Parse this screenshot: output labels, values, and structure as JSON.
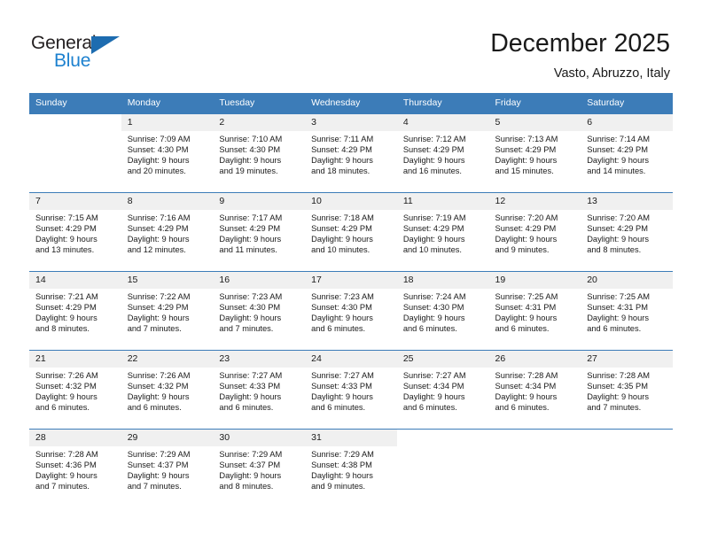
{
  "brand": {
    "name_part1": "General",
    "name_part2": "Blue",
    "triangle_color": "#1d6cb0",
    "blue_color": "#1d81cf"
  },
  "header": {
    "title": "December 2025",
    "subtitle": "Vasto, Abruzzo, Italy"
  },
  "theme": {
    "header_row_bg": "#3c7cb8",
    "daynum_bg": "#f0f0f0",
    "row_border": "#3c7cb8"
  },
  "weekdays": [
    "Sunday",
    "Monday",
    "Tuesday",
    "Wednesday",
    "Thursday",
    "Friday",
    "Saturday"
  ],
  "weeks": [
    [
      {
        "day": "",
        "sunrise": "",
        "sunset": "",
        "daylight1": "",
        "daylight2": ""
      },
      {
        "day": "1",
        "sunrise": "Sunrise: 7:09 AM",
        "sunset": "Sunset: 4:30 PM",
        "daylight1": "Daylight: 9 hours",
        "daylight2": "and 20 minutes."
      },
      {
        "day": "2",
        "sunrise": "Sunrise: 7:10 AM",
        "sunset": "Sunset: 4:30 PM",
        "daylight1": "Daylight: 9 hours",
        "daylight2": "and 19 minutes."
      },
      {
        "day": "3",
        "sunrise": "Sunrise: 7:11 AM",
        "sunset": "Sunset: 4:29 PM",
        "daylight1": "Daylight: 9 hours",
        "daylight2": "and 18 minutes."
      },
      {
        "day": "4",
        "sunrise": "Sunrise: 7:12 AM",
        "sunset": "Sunset: 4:29 PM",
        "daylight1": "Daylight: 9 hours",
        "daylight2": "and 16 minutes."
      },
      {
        "day": "5",
        "sunrise": "Sunrise: 7:13 AM",
        "sunset": "Sunset: 4:29 PM",
        "daylight1": "Daylight: 9 hours",
        "daylight2": "and 15 minutes."
      },
      {
        "day": "6",
        "sunrise": "Sunrise: 7:14 AM",
        "sunset": "Sunset: 4:29 PM",
        "daylight1": "Daylight: 9 hours",
        "daylight2": "and 14 minutes."
      }
    ],
    [
      {
        "day": "7",
        "sunrise": "Sunrise: 7:15 AM",
        "sunset": "Sunset: 4:29 PM",
        "daylight1": "Daylight: 9 hours",
        "daylight2": "and 13 minutes."
      },
      {
        "day": "8",
        "sunrise": "Sunrise: 7:16 AM",
        "sunset": "Sunset: 4:29 PM",
        "daylight1": "Daylight: 9 hours",
        "daylight2": "and 12 minutes."
      },
      {
        "day": "9",
        "sunrise": "Sunrise: 7:17 AM",
        "sunset": "Sunset: 4:29 PM",
        "daylight1": "Daylight: 9 hours",
        "daylight2": "and 11 minutes."
      },
      {
        "day": "10",
        "sunrise": "Sunrise: 7:18 AM",
        "sunset": "Sunset: 4:29 PM",
        "daylight1": "Daylight: 9 hours",
        "daylight2": "and 10 minutes."
      },
      {
        "day": "11",
        "sunrise": "Sunrise: 7:19 AM",
        "sunset": "Sunset: 4:29 PM",
        "daylight1": "Daylight: 9 hours",
        "daylight2": "and 10 minutes."
      },
      {
        "day": "12",
        "sunrise": "Sunrise: 7:20 AM",
        "sunset": "Sunset: 4:29 PM",
        "daylight1": "Daylight: 9 hours",
        "daylight2": "and 9 minutes."
      },
      {
        "day": "13",
        "sunrise": "Sunrise: 7:20 AM",
        "sunset": "Sunset: 4:29 PM",
        "daylight1": "Daylight: 9 hours",
        "daylight2": "and 8 minutes."
      }
    ],
    [
      {
        "day": "14",
        "sunrise": "Sunrise: 7:21 AM",
        "sunset": "Sunset: 4:29 PM",
        "daylight1": "Daylight: 9 hours",
        "daylight2": "and 8 minutes."
      },
      {
        "day": "15",
        "sunrise": "Sunrise: 7:22 AM",
        "sunset": "Sunset: 4:29 PM",
        "daylight1": "Daylight: 9 hours",
        "daylight2": "and 7 minutes."
      },
      {
        "day": "16",
        "sunrise": "Sunrise: 7:23 AM",
        "sunset": "Sunset: 4:30 PM",
        "daylight1": "Daylight: 9 hours",
        "daylight2": "and 7 minutes."
      },
      {
        "day": "17",
        "sunrise": "Sunrise: 7:23 AM",
        "sunset": "Sunset: 4:30 PM",
        "daylight1": "Daylight: 9 hours",
        "daylight2": "and 6 minutes."
      },
      {
        "day": "18",
        "sunrise": "Sunrise: 7:24 AM",
        "sunset": "Sunset: 4:30 PM",
        "daylight1": "Daylight: 9 hours",
        "daylight2": "and 6 minutes."
      },
      {
        "day": "19",
        "sunrise": "Sunrise: 7:25 AM",
        "sunset": "Sunset: 4:31 PM",
        "daylight1": "Daylight: 9 hours",
        "daylight2": "and 6 minutes."
      },
      {
        "day": "20",
        "sunrise": "Sunrise: 7:25 AM",
        "sunset": "Sunset: 4:31 PM",
        "daylight1": "Daylight: 9 hours",
        "daylight2": "and 6 minutes."
      }
    ],
    [
      {
        "day": "21",
        "sunrise": "Sunrise: 7:26 AM",
        "sunset": "Sunset: 4:32 PM",
        "daylight1": "Daylight: 9 hours",
        "daylight2": "and 6 minutes."
      },
      {
        "day": "22",
        "sunrise": "Sunrise: 7:26 AM",
        "sunset": "Sunset: 4:32 PM",
        "daylight1": "Daylight: 9 hours",
        "daylight2": "and 6 minutes."
      },
      {
        "day": "23",
        "sunrise": "Sunrise: 7:27 AM",
        "sunset": "Sunset: 4:33 PM",
        "daylight1": "Daylight: 9 hours",
        "daylight2": "and 6 minutes."
      },
      {
        "day": "24",
        "sunrise": "Sunrise: 7:27 AM",
        "sunset": "Sunset: 4:33 PM",
        "daylight1": "Daylight: 9 hours",
        "daylight2": "and 6 minutes."
      },
      {
        "day": "25",
        "sunrise": "Sunrise: 7:27 AM",
        "sunset": "Sunset: 4:34 PM",
        "daylight1": "Daylight: 9 hours",
        "daylight2": "and 6 minutes."
      },
      {
        "day": "26",
        "sunrise": "Sunrise: 7:28 AM",
        "sunset": "Sunset: 4:34 PM",
        "daylight1": "Daylight: 9 hours",
        "daylight2": "and 6 minutes."
      },
      {
        "day": "27",
        "sunrise": "Sunrise: 7:28 AM",
        "sunset": "Sunset: 4:35 PM",
        "daylight1": "Daylight: 9 hours",
        "daylight2": "and 7 minutes."
      }
    ],
    [
      {
        "day": "28",
        "sunrise": "Sunrise: 7:28 AM",
        "sunset": "Sunset: 4:36 PM",
        "daylight1": "Daylight: 9 hours",
        "daylight2": "and 7 minutes."
      },
      {
        "day": "29",
        "sunrise": "Sunrise: 7:29 AM",
        "sunset": "Sunset: 4:37 PM",
        "daylight1": "Daylight: 9 hours",
        "daylight2": "and 7 minutes."
      },
      {
        "day": "30",
        "sunrise": "Sunrise: 7:29 AM",
        "sunset": "Sunset: 4:37 PM",
        "daylight1": "Daylight: 9 hours",
        "daylight2": "and 8 minutes."
      },
      {
        "day": "31",
        "sunrise": "Sunrise: 7:29 AM",
        "sunset": "Sunset: 4:38 PM",
        "daylight1": "Daylight: 9 hours",
        "daylight2": "and 9 minutes."
      },
      {
        "day": "",
        "sunrise": "",
        "sunset": "",
        "daylight1": "",
        "daylight2": ""
      },
      {
        "day": "",
        "sunrise": "",
        "sunset": "",
        "daylight1": "",
        "daylight2": ""
      },
      {
        "day": "",
        "sunrise": "",
        "sunset": "",
        "daylight1": "",
        "daylight2": ""
      }
    ]
  ]
}
